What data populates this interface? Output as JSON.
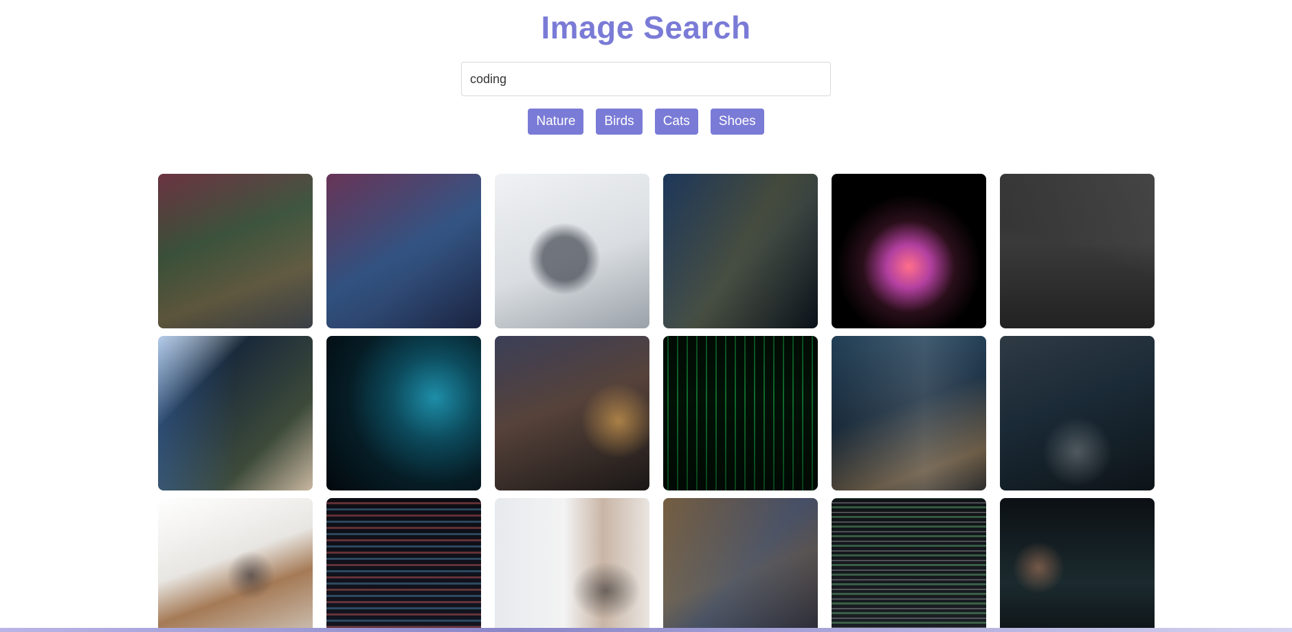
{
  "header": {
    "title": "Image Search"
  },
  "search": {
    "value": "coding",
    "placeholder": ""
  },
  "categories": [
    "Nature",
    "Birds",
    "Cats",
    "Shoes"
  ],
  "colors": {
    "accent": "#7a7bd6",
    "background": "#ffffff"
  },
  "results": [
    {
      "bg": "linear-gradient(135deg,#1c1f24,#2d3138 60%,#3a3f46)",
      "overlay": "linear-gradient(160deg,rgba(255,90,120,0.35),rgba(120,200,90,0.25) 40%,rgba(240,200,80,0.25) 70%,transparent)"
    },
    {
      "bg": "linear-gradient(135deg,#17203a,#23304f 60%,#1a2340)",
      "overlay": "linear-gradient(150deg,rgba(255,90,140,0.35),rgba(90,170,255,0.3) 50%,transparent)"
    },
    {
      "bg": "linear-gradient(160deg,#f0f2f4,#d9dde1 55%,#9aa1a8)",
      "overlay": "radial-gradient(circle at 45% 55%,rgba(40,45,55,0.6) 0,rgba(40,45,55,0.6) 18%,transparent 30%)"
    },
    {
      "bg": "linear-gradient(135deg,#0e1621,#1d2b3c 55%,#0a1018)",
      "overlay": "linear-gradient(120deg,rgba(60,120,200,0.35),rgba(240,220,90,0.2) 50%,transparent)"
    },
    {
      "bg": "radial-gradient(circle at 50% 60%,#ff6f8a 0,#b340a0 18%,#2a0f1a 38%,#000000 60%)",
      "overlay": "none"
    },
    {
      "bg": "linear-gradient(180deg,#2b2b2b,#3a3a3a 45%,#222222)",
      "overlay": "linear-gradient(200deg,rgba(255,255,255,0.12),transparent 50%)"
    },
    {
      "bg": "linear-gradient(135deg,#e9eef2,#1a2a3a 30%,#3d4a3a 70%,#c9b7a0)",
      "overlay": "linear-gradient(90deg,rgba(80,140,220,0.35),transparent 50%)"
    },
    {
      "bg": "radial-gradient(circle at 70% 40%,#1e8ea8 0,#0c4a5c 30%,#061d26 60%,#02080c 100%)",
      "overlay": "none"
    },
    {
      "bg": "linear-gradient(160deg,#3b3f58,#56423a 45%,#1a1716)",
      "overlay": "radial-gradient(circle at 80% 55%,rgba(255,190,90,0.55) 0,transparent 25%)"
    },
    {
      "bg": "repeating-linear-gradient(90deg,#021006 0,#021006 6px,#0f6b2c 6px,#0f6b2c 8px,#021006 8px,#021006 14px)",
      "overlay": "linear-gradient(180deg,rgba(0,0,0,0.3),transparent 40%,rgba(0,0,0,0.4))"
    },
    {
      "bg": "linear-gradient(160deg,#2a4e6a,#1f3447 45%,#6a5a44 80%,#2b2b2b)",
      "overlay": "linear-gradient(90deg,rgba(0,0,0,0.2),rgba(220,220,220,0.15) 60%,transparent)"
    },
    {
      "bg": "linear-gradient(160deg,#2f3a44,#1a2a36 45%,#0e1418)",
      "overlay": "radial-gradient(circle at 50% 75%,rgba(255,255,255,0.25) 0,transparent 25%)"
    },
    {
      "bg": "linear-gradient(160deg,#ffffff,#e8e6e2 40%,#a57a56 60%,#d8d4cd)",
      "overlay": "radial-gradient(circle at 60% 50%,rgba(30,30,40,0.55) 0,transparent 20%)"
    },
    {
      "bg": "linear-gradient(180deg,#0d0e14,#141622)",
      "overlay": "repeating-linear-gradient(0deg,rgba(255,110,110,0.35) 0,rgba(255,110,110,0.35) 3px,transparent 3px,transparent 9px,rgba(110,200,255,0.3) 9px,rgba(110,200,255,0.3) 12px,transparent 12px,transparent 18px)"
    },
    {
      "bg": "linear-gradient(90deg,#e7eaee,#f3f3f3 45%,#c9b5a6 70%,#e9e5e0)",
      "overlay": "radial-gradient(ellipse at 72% 60%,rgba(30,30,30,0.55) 0,transparent 22%)"
    },
    {
      "bg": "linear-gradient(160deg,#2a2438,#5a4430 50%,#1d2030)",
      "overlay": "linear-gradient(130deg,rgba(255,200,80,0.35),rgba(80,160,255,0.25) 50%,transparent)"
    },
    {
      "bg": "linear-gradient(180deg,#101317,#1d2127)",
      "overlay": "repeating-linear-gradient(0deg,rgba(120,220,140,0.35) 0,rgba(120,220,140,0.35) 3px,transparent 3px,transparent 7px,rgba(255,255,255,0.25) 7px,rgba(255,255,255,0.25) 9px,transparent 9px,transparent 14px)"
    },
    {
      "bg": "linear-gradient(180deg,#0c1014,#1b2a2e 55%,#0a0c10)",
      "overlay": "radial-gradient(circle at 25% 45%,rgba(230,150,110,0.45) 0,transparent 18%)"
    }
  ]
}
